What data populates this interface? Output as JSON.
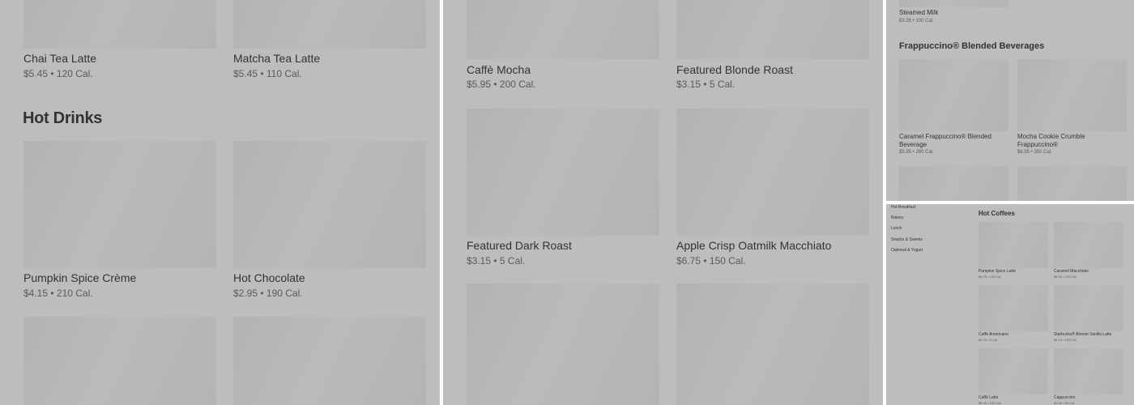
{
  "panel1": {
    "top_items": [
      {
        "name": "Chai Tea Latte",
        "meta": "$5.45 • 120 Cal."
      },
      {
        "name": "Matcha Tea Latte",
        "meta": "$5.45 • 110 Cal."
      }
    ],
    "section_title": "Hot Drinks",
    "items": [
      {
        "name": "Pumpkin Spice Crème",
        "meta": "$4.15 • 210 Cal."
      },
      {
        "name": "Hot Chocolate",
        "meta": "$2.95 • 190 Cal."
      }
    ]
  },
  "panel2": {
    "items": [
      {
        "name": "Caffè Mocha",
        "meta": "$5.95 • 200 Cal."
      },
      {
        "name": "Featured Blonde Roast",
        "meta": "$3.15 • 5 Cal."
      },
      {
        "name": "Featured Dark Roast",
        "meta": "$3.15 • 5 Cal."
      },
      {
        "name": "Apple Crisp Oatmilk Macchiato",
        "meta": "$6.75 • 150 Cal."
      }
    ]
  },
  "panel3": {
    "top_item": {
      "name": "Steamed Milk",
      "meta": "$3.25 • 100 Cal."
    },
    "section_title": "Frappuccino® Blended Beverages",
    "items": [
      {
        "name": "Caramel Frappuccino® Blended Beverage",
        "meta": "$5.95 • 280 Cal."
      },
      {
        "name": "Mocha Cookie Crumble Frappuccino®",
        "meta": "$6.95 • 350 Cal."
      }
    ]
  },
  "panel4": {
    "sidebar": [
      "Hot Breakfast",
      "Bakery",
      "Lunch",
      "Snacks & Sweets",
      "Oatmeal & Yogurt"
    ],
    "section_title": "Hot Coffees",
    "items": [
      {
        "name": "Pumpkin Spice Latte",
        "meta": "$6.75 • 120 Cal."
      },
      {
        "name": "Caramel Macchiato",
        "meta": "$6.25 • 120 Cal."
      },
      {
        "name": "Caffè Americano",
        "meta": "$4.25 • 5 Cal."
      },
      {
        "name": "Starbucks® Blonde Vanilla Latte",
        "meta": "$6.15 • 130 Cal."
      },
      {
        "name": "Caffè Latte",
        "meta": "$5.45 • 130 Cal."
      },
      {
        "name": "Cappuccino",
        "meta": "$5.45 • 90 Cal."
      }
    ]
  }
}
